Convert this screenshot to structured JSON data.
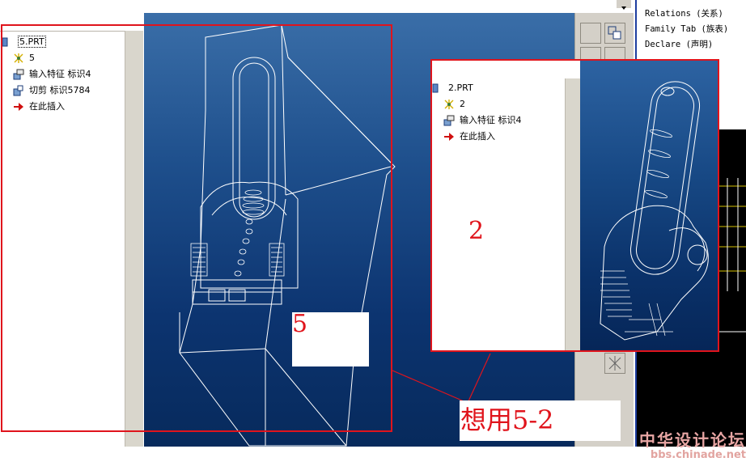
{
  "main_window": {
    "tree": [
      {
        "label": "5.PRT",
        "icon": "part-icon"
      },
      {
        "label": "5",
        "icon": "datum-star-icon"
      },
      {
        "label": "输入特征 标识4",
        "icon": "import-feature-icon"
      },
      {
        "label": "切剪 标识5784",
        "icon": "cut-feature-icon"
      },
      {
        "label": "在此插入",
        "icon": "insert-here-arrow-icon"
      }
    ]
  },
  "overlay_window": {
    "tree": [
      {
        "label": "2.PRT",
        "icon": "part-icon"
      },
      {
        "label": "2",
        "icon": "datum-star-icon"
      },
      {
        "label": "输入特征 标识4",
        "icon": "import-feature-icon"
      },
      {
        "label": "在此插入",
        "icon": "insert-here-arrow-icon"
      }
    ]
  },
  "menu": {
    "items": [
      "Relations (关系)",
      "Family Tab (族表)",
      "Declare (声明)"
    ]
  },
  "annotations": {
    "label_main": "5",
    "label_overlay": "2",
    "caption": "想用5-2"
  },
  "watermark": {
    "line1": "中华设计论坛",
    "line2": "bbs.chinade.net"
  },
  "colors": {
    "annotation_red": "#e0141c",
    "viewport_blue": "#0c3470",
    "wireframe": "#ffffff"
  }
}
